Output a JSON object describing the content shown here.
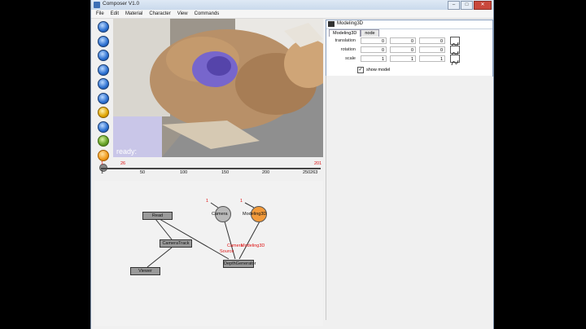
{
  "window": {
    "title": "Composer V1.0"
  },
  "menu": [
    "File",
    "Edit",
    "Material",
    "Character",
    "View",
    "Commands"
  ],
  "viewport": {
    "status": "ready:"
  },
  "timeline": {
    "start_marker": "1",
    "current_marker": "26",
    "end_marker": "201",
    "ticks": [
      "1",
      "50",
      "100",
      "150",
      "200",
      "250263"
    ]
  },
  "graph": {
    "nodes": {
      "read": "Read",
      "camera_track": "CameraTrack",
      "viewer": "Viewer",
      "depth_generator": "DepthGenerator",
      "camera": "Camera",
      "modeling3d": "Modeling3D"
    },
    "camera_badge": "1",
    "modeling_badge": "1",
    "edge_label_camera": "Camera",
    "edge_label_modeling": "Modeling3D",
    "edge_label_source": "Source"
  },
  "panel": {
    "title": "Modeling3D",
    "tabs": [
      "Modeling3D",
      "node"
    ],
    "rows": [
      {
        "label": "translation",
        "values": [
          "0",
          "0",
          "0"
        ]
      },
      {
        "label": "rotation",
        "values": [
          "0",
          "0",
          "0"
        ]
      },
      {
        "label": "scale",
        "values": [
          "1",
          "1",
          "1"
        ]
      }
    ],
    "show_model_label": "show model",
    "show_model_checked": "✓"
  },
  "colors": {
    "camera_node": "#b9b9b9",
    "modeling_node": "#f29a3a",
    "accent_red": "#dd1111"
  }
}
